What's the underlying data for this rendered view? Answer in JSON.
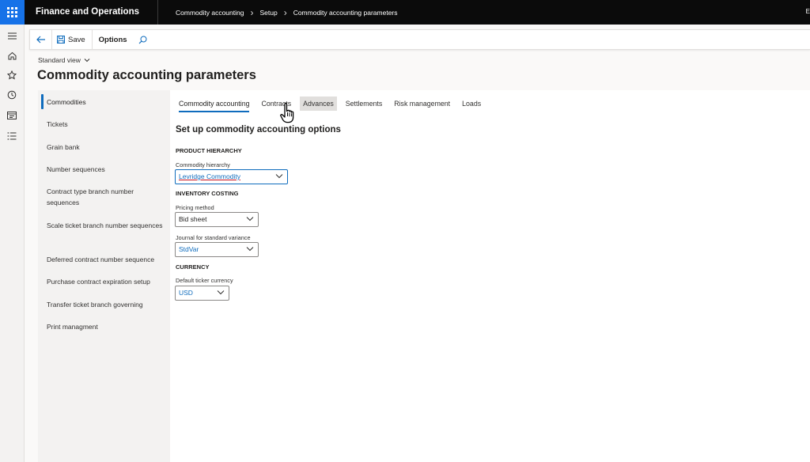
{
  "header": {
    "app_title": "Finance and Operations",
    "breadcrumb": [
      "Commodity accounting",
      "Setup",
      "Commodity accounting parameters"
    ],
    "right_text": "E"
  },
  "action_pane": {
    "save_label": "Save",
    "options_label": "Options"
  },
  "page": {
    "view_label": "Standard view",
    "title": "Commodity accounting parameters"
  },
  "sidelist": {
    "items": [
      "Commodities",
      "Tickets",
      "Grain bank",
      "Number sequences",
      "Contract type branch number sequences",
      "Scale ticket branch number sequences",
      "Deferred contract number sequence",
      "Purchase contract expiration setup",
      "Transfer ticket branch governing",
      "Print managment"
    ],
    "active_index": 0
  },
  "tabs": [
    "Commodity accounting",
    "Contracts",
    "Advances",
    "Settlements",
    "Risk management",
    "Loads"
  ],
  "form": {
    "section_title": "Set up commodity accounting options",
    "product_hierarchy_header": "PRODUCT HIERARCHY",
    "commodity_hierarchy_label": "Commodity hierarchy",
    "commodity_hierarchy_value": "Levridge Commodity",
    "inventory_costing_header": "INVENTORY COSTING",
    "pricing_method_label": "Pricing method",
    "pricing_method_value": "Bid sheet",
    "journal_label": "Journal for standard variance",
    "journal_value": "StdVar",
    "currency_header": "CURRENCY",
    "ticker_currency_label": "Default ticker currency",
    "ticker_currency_value": "USD"
  },
  "colors": {
    "topbar": "#0b0b0b",
    "waffle": "#1672e8",
    "accent": "#0f6cbd"
  }
}
